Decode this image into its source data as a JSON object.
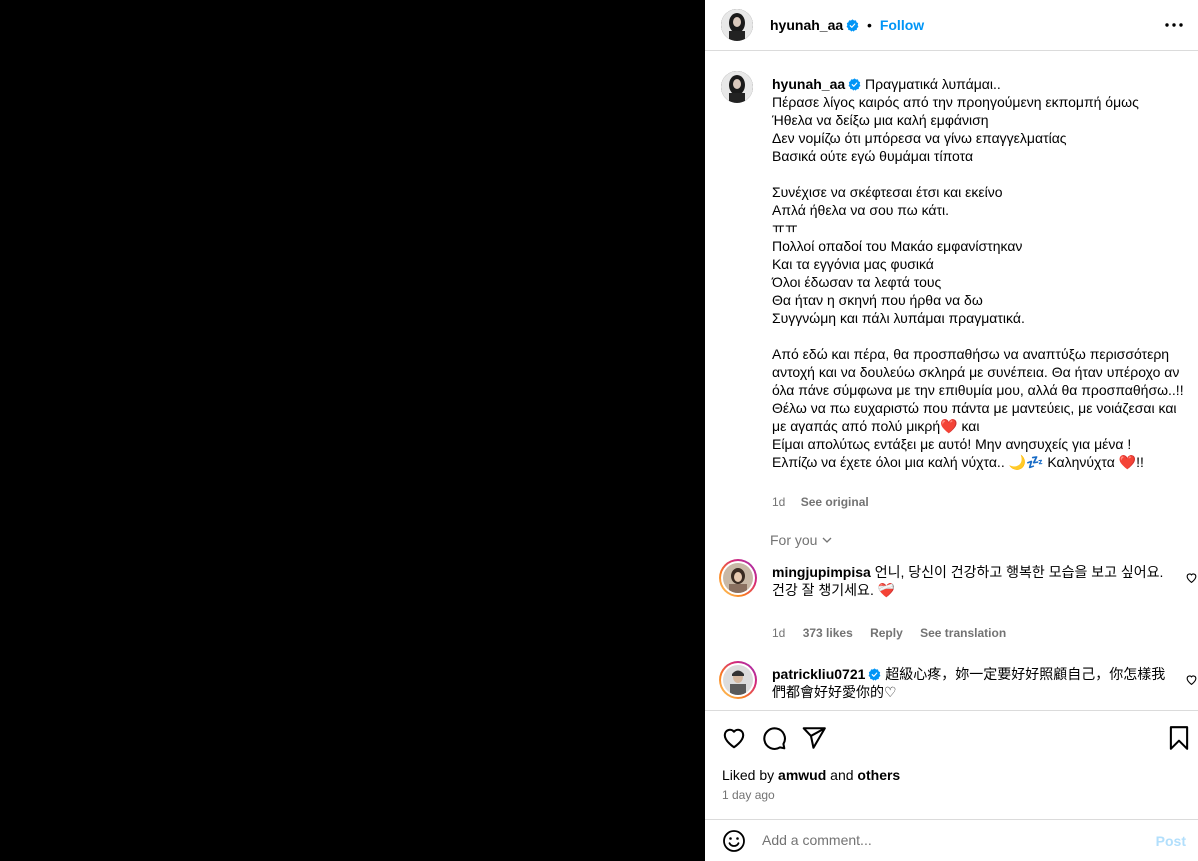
{
  "post": {
    "author": "hyunah_aa",
    "follow_label": "Follow",
    "caption_lines": "Πραγματικά λυπάμαι..\nΠέρασε λίγος καιρός από την προηγούμενη εκπομπή όμως\nΉθελα να δείξω μια καλή εμφάνιση\nΔεν νομίζω ότι μπόρεσα να γίνω επαγγελματίας\nΒασικά ούτε εγώ θυμάμαι τίποτα\n\nΣυνέχισε να σκέφτεσαι έτσι και εκείνο\nΑπλά ήθελα να σου πω κάτι.\nㅠㅠ\nΠολλοί οπαδοί του Μακάο εμφανίστηκαν\nΚαι τα εγγόνια μας φυσικά\nΌλοι έδωσαν τα λεφτά τους\nΘα ήταν η σκηνή που ήρθα να δω\nΣυγγνώμη και πάλι λυπάμαι πραγματικά.\n\nΑπό εδώ και πέρα, θα προσπαθήσω να αναπτύξω περισσότερη αντοχή και να δουλεύω σκληρά με συνέπεια. Θα ήταν υπέροχο αν όλα πάνε σύμφωνα με την επιθυμία μου, αλλά θα προσπαθήσω..!!\nΘέλω να πω ευχαριστώ που πάντα με μαντεύεις, με νοιάζεσαι και με αγαπάς από πολύ μικρή❤️ και\nΕίμαι απολύτως εντάξει με αυτό! Μην ανησυχείς για μένα !\nΕλπίζω να έχετε όλοι μια καλή νύχτα.. 🌙💤 Καληνύχτα ❤️!!",
    "caption_time": "1d",
    "see_original": "See original",
    "for_you": "For you"
  },
  "comments": [
    {
      "username": "mingjupimpisa",
      "text": "언니, 당신이 건강하고 행복한 모습을 보고 싶어요.\n건강 잘 챙기세요. ❤️‍🩹",
      "time": "1d",
      "likes": "373 likes",
      "reply": "Reply",
      "translation": "See translation"
    },
    {
      "username": "patrickliu0721",
      "text": "超級心疼，妳一定要好好照顧自己，你怎樣我們都會好好愛你的♡"
    }
  ],
  "footer": {
    "liked_prefix": "Liked by ",
    "liked_user": "amwud",
    "liked_and": " and ",
    "liked_others": "others",
    "time": "1 day ago",
    "comment_placeholder": "Add a comment...",
    "post_label": "Post"
  },
  "icons": {
    "verified": "verified-badge-icon",
    "more": "more-options-icon",
    "like": "heart-icon",
    "comment": "comment-bubble-icon",
    "share": "paper-plane-icon",
    "save": "bookmark-icon",
    "emoji": "emoji-icon",
    "chevron": "chevron-down-icon"
  },
  "colors": {
    "accent": "#0095f6",
    "muted": "#737373",
    "border": "#dbdbdb"
  }
}
